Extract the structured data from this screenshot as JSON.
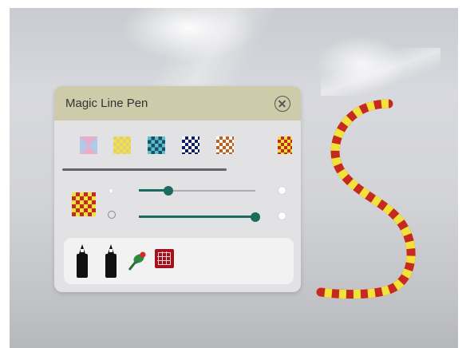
{
  "panel": {
    "title": "Magic Line Pen",
    "close_icon": "close-circle-icon"
  },
  "patterns": [
    {
      "name": "pattern-knot-pastel",
      "icon": "pattern-swatch-icon"
    },
    {
      "name": "pattern-yellow-diamond",
      "icon": "pattern-swatch-icon"
    },
    {
      "name": "pattern-teal-weave",
      "icon": "pattern-swatch-icon"
    },
    {
      "name": "pattern-navy-check",
      "icon": "pattern-swatch-icon"
    },
    {
      "name": "pattern-orange-check",
      "icon": "pattern-swatch-icon"
    },
    {
      "name": "pattern-red-yellow-check",
      "icon": "pattern-swatch-icon"
    }
  ],
  "controls": {
    "current_pattern": "red-yellow-checker",
    "width_slider_value": 0.25,
    "opacity_slider_value": 1.0
  },
  "tools": [
    {
      "icon": "marker-pen-icon"
    },
    {
      "icon": "marker-pen-icon"
    },
    {
      "icon": "bird-pen-icon"
    },
    {
      "icon": "chinese-knot-icon"
    }
  ],
  "colors": {
    "header": "#cecbaa",
    "panel": "#e2e2e4",
    "accent": "#1b6b5e",
    "stroke_red": "#c42a1f",
    "stroke_yellow": "#f3e23a"
  }
}
